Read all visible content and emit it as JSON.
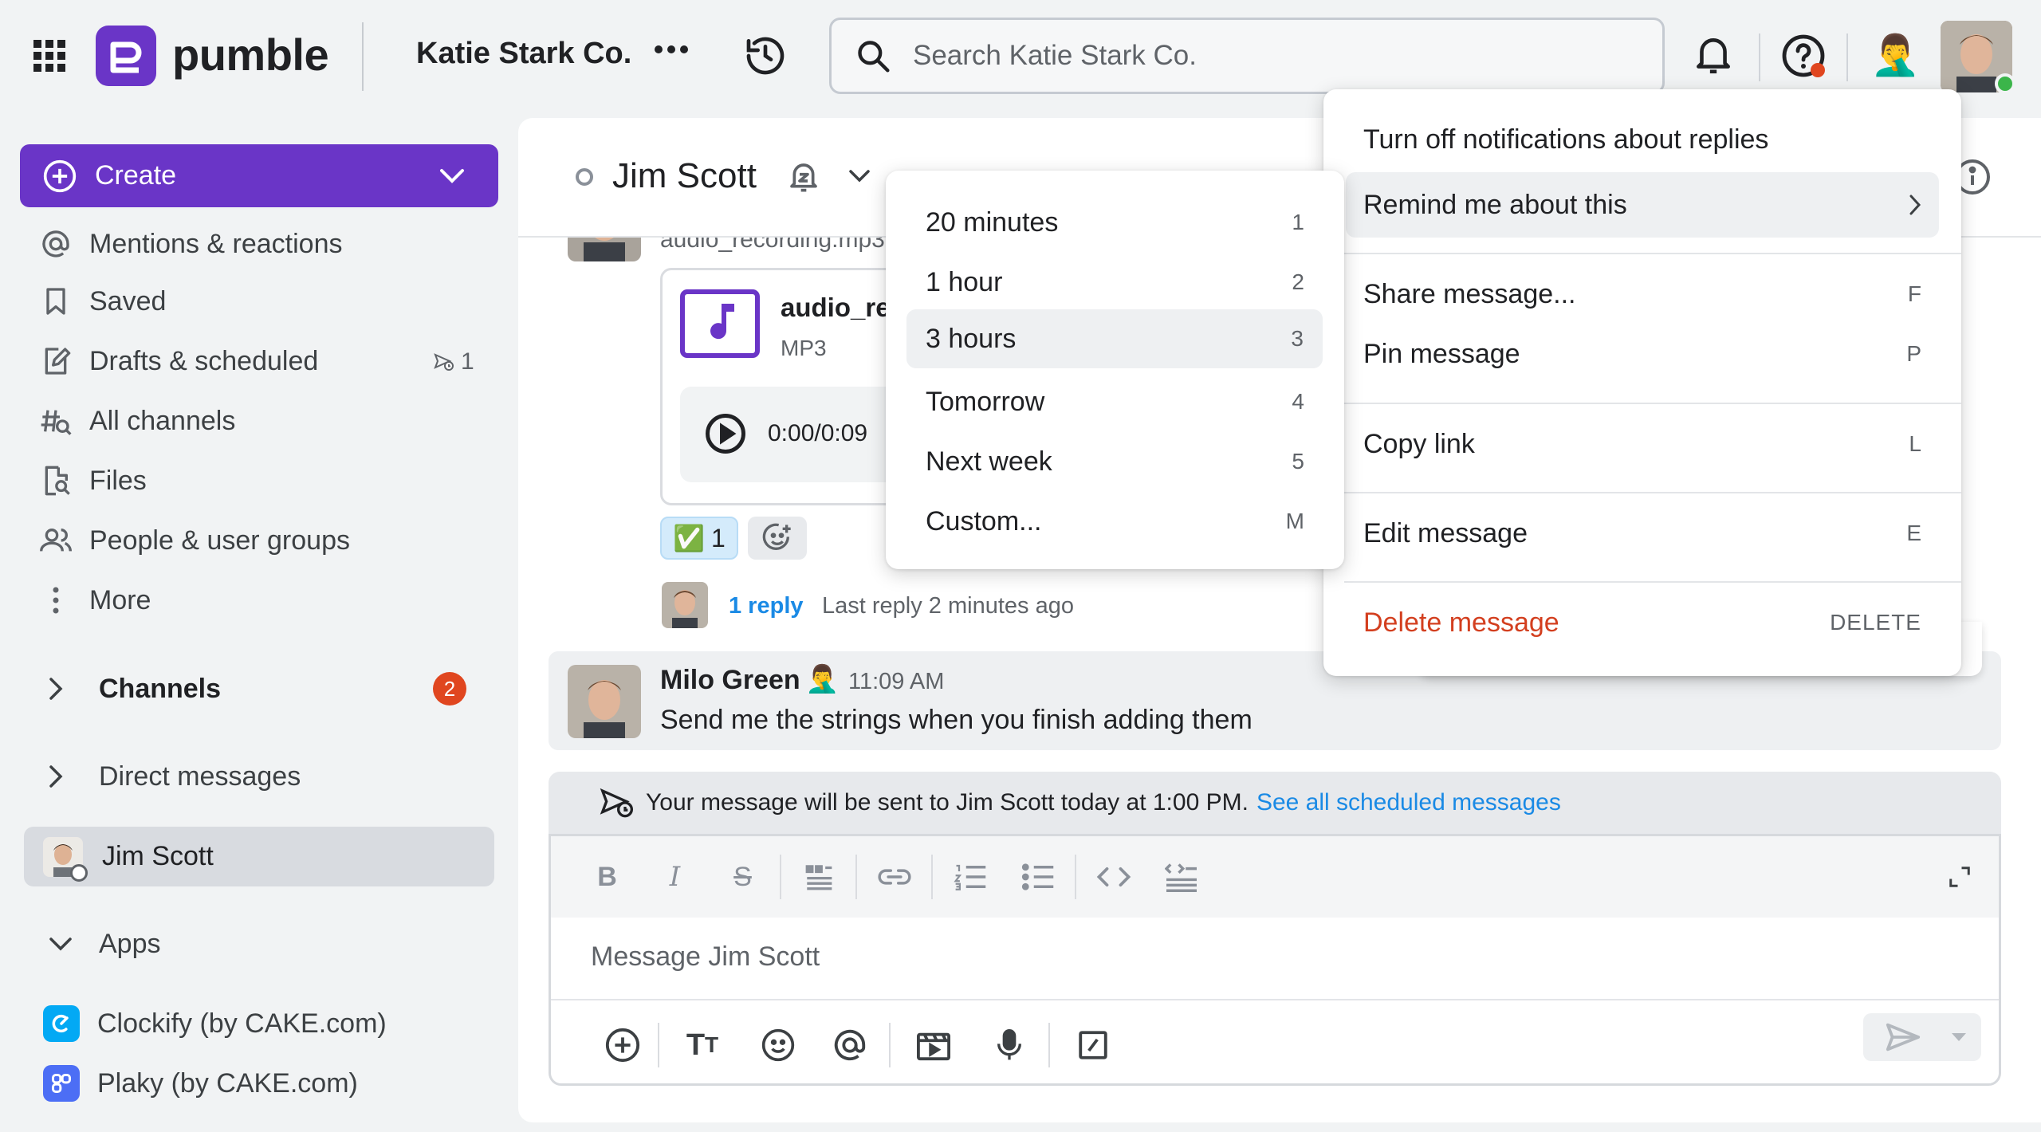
{
  "app": {
    "brand": "pumble",
    "workspace": "Katie Stark Co.",
    "search_placeholder": "Search Katie Stark Co."
  },
  "sidebar": {
    "create_label": "Create",
    "items": [
      {
        "label": "Mentions & reactions",
        "icon": "at-icon"
      },
      {
        "label": "Saved",
        "icon": "bookmark-icon"
      },
      {
        "label": "Drafts & scheduled",
        "icon": "draft-icon",
        "badge": "1"
      },
      {
        "label": "All channels",
        "icon": "channels-search-icon"
      },
      {
        "label": "Files",
        "icon": "file-search-icon"
      },
      {
        "label": "People & user groups",
        "icon": "people-icon"
      },
      {
        "label": "More",
        "icon": "more-vertical-icon"
      }
    ],
    "channels": {
      "label": "Channels",
      "badge": "2"
    },
    "direct_messages": {
      "label": "Direct messages"
    },
    "active_dm": {
      "label": "Jim Scott"
    },
    "apps": {
      "label": "Apps",
      "items": [
        {
          "label": "Clockify (by CAKE.com)",
          "color": "#03a9f4"
        },
        {
          "label": "Plaky (by CAKE.com)",
          "color": "#4c6ef5"
        }
      ]
    }
  },
  "conversation": {
    "title": "Jim Scott",
    "attachment": {
      "filename": "audio_recording.mp3",
      "card_name": "audio_re",
      "type": "MP3",
      "time": "0:00/0:09"
    },
    "reaction": {
      "emoji": "✅",
      "count": "1"
    },
    "thread": {
      "replies": "1 reply",
      "last_reply": "Last reply 2 minutes ago"
    },
    "message": {
      "author": "Milo Green",
      "status_emoji": "🤦‍♂️",
      "time": "11:09 AM",
      "text": "Send me the strings when you finish adding them"
    },
    "scheduled": {
      "text": "Your message will be sent to Jim Scott today at 1:00 PM.",
      "link": "See all scheduled messages"
    },
    "composer_placeholder": "Message Jim Scott"
  },
  "remind_menu": {
    "items": [
      {
        "label": "20 minutes",
        "shortcut": "1"
      },
      {
        "label": "1 hour",
        "shortcut": "2"
      },
      {
        "label": "3 hours",
        "shortcut": "3"
      },
      {
        "label": "Tomorrow",
        "shortcut": "4"
      },
      {
        "label": "Next week",
        "shortcut": "5"
      },
      {
        "label": "Custom...",
        "shortcut": "M"
      }
    ]
  },
  "context_menu": {
    "notifications": "Turn off notifications about replies",
    "remind": "Remind me about this",
    "share": {
      "label": "Share message...",
      "shortcut": "F"
    },
    "pin": {
      "label": "Pin message",
      "shortcut": "P"
    },
    "copy": {
      "label": "Copy link",
      "shortcut": "L"
    },
    "edit": {
      "label": "Edit message",
      "shortcut": "E"
    },
    "delete": {
      "label": "Delete message",
      "shortcut": "DELETE"
    }
  },
  "colors": {
    "brand": "#6a35c7",
    "link": "#1a8ae5",
    "danger": "#d33f1f",
    "badge": "#e0461f"
  }
}
